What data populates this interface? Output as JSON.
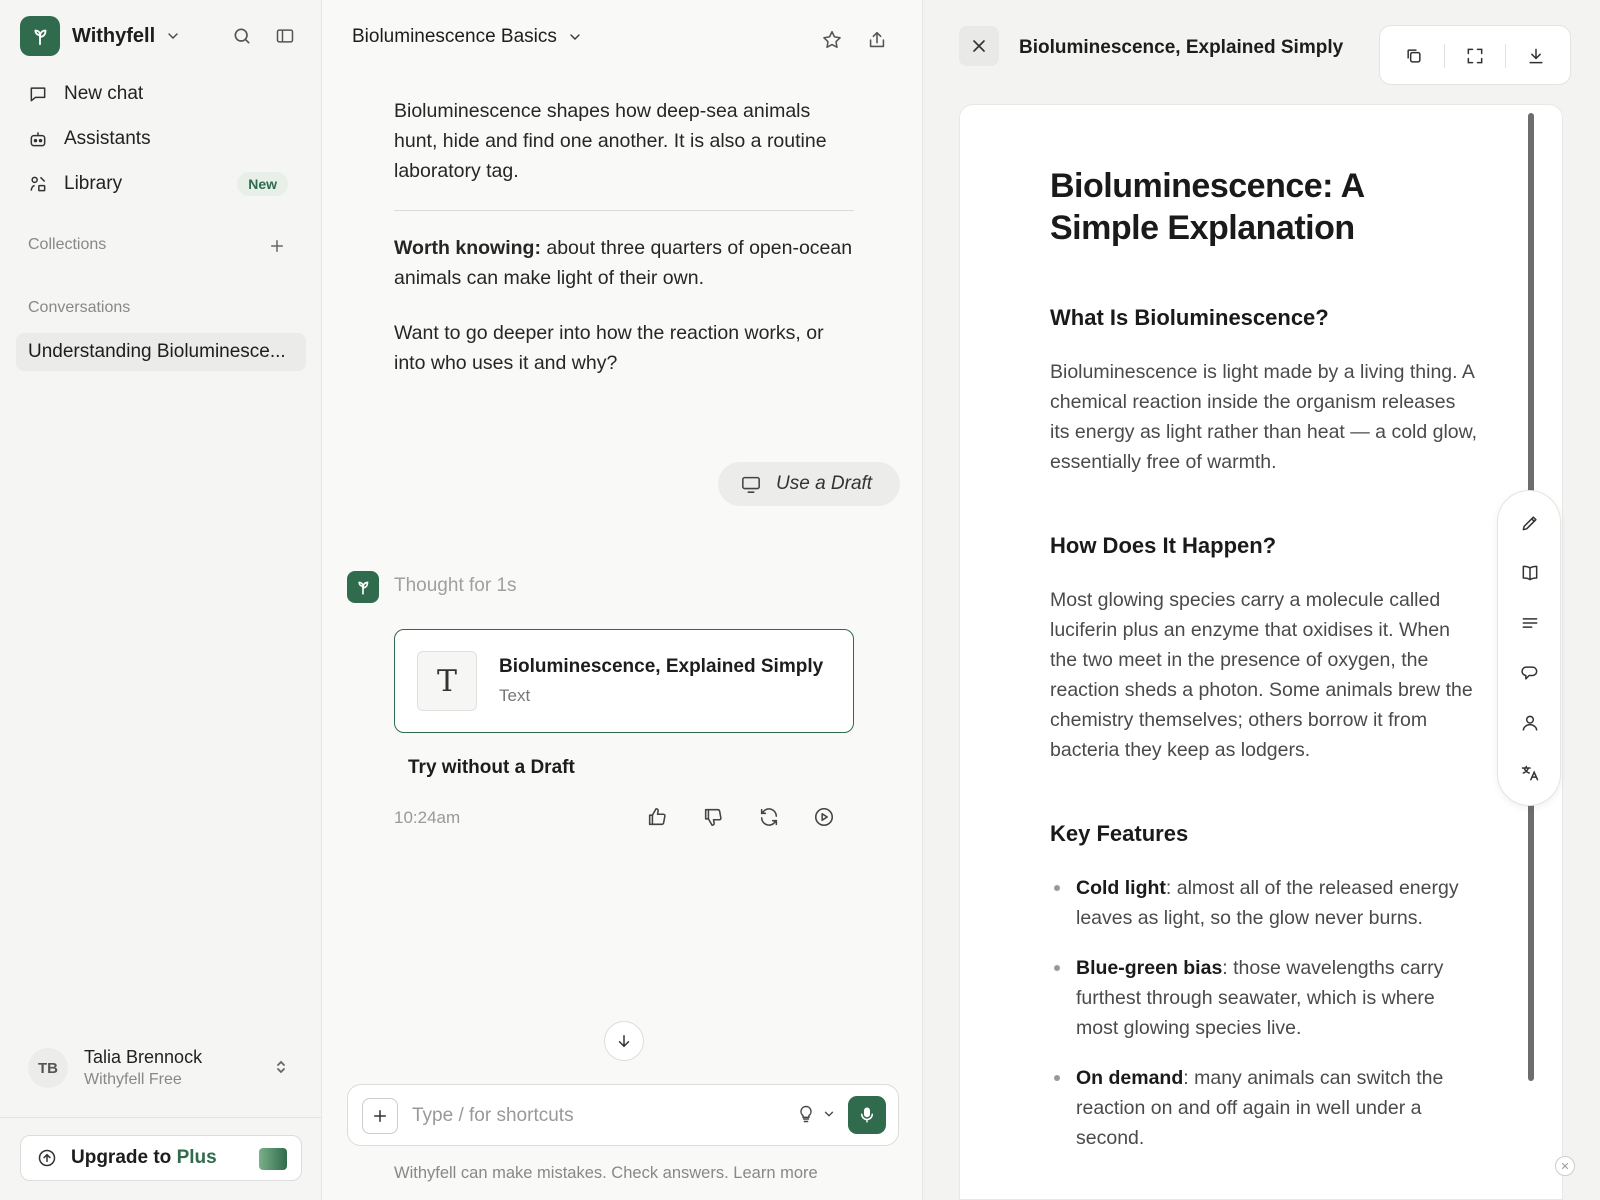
{
  "sidebar": {
    "brand": "Withyfell",
    "nav": [
      {
        "label": "New chat"
      },
      {
        "label": "Assistants"
      },
      {
        "label": "Library",
        "badge": "New"
      }
    ],
    "collections_title": "Collections",
    "conversations_title": "Conversations",
    "conversations": [
      "Understanding Bioluminesce..."
    ],
    "user": {
      "initials": "TB",
      "name": "Talia Brennock",
      "plan": "Withyfell Free"
    },
    "upgrade": {
      "prefix": "Upgrade to",
      "plan": "Plus"
    }
  },
  "chat": {
    "title": "Bioluminescence Basics",
    "messages": {
      "intro": "Bioluminescence shapes how deep-sea animals hunt, hide and find one another. It is also a routine laboratory tag.",
      "worth_label": "Worth knowing:",
      "worth_text": " about three quarters of open-ocean animals can make light of their own.",
      "question": "Want to go deeper into how the reaction works, or into who uses it and why?"
    },
    "draft_pill": "Use a Draft",
    "thought": "Thought for 1s",
    "artifact": {
      "icon_letter": "T",
      "title": "Bioluminescence, Explained Simply",
      "type": "Text"
    },
    "try_without": "Try without a Draft",
    "time": "10:24am",
    "composer": {
      "placeholder": "Type / for shortcuts"
    },
    "disclaimer": "Withyfell can make mistakes. Check answers.",
    "learn_more": "Learn more"
  },
  "panel": {
    "title": "Bioluminescence, Explained Simply",
    "doc": {
      "h1": "Bioluminescence: A Simple Explanation",
      "s1_title": "What Is Bioluminescence?",
      "s1_text": "Bioluminescence is light made by a living thing. A chemical reaction inside the organism releases its energy as light rather than heat — a cold glow, essentially free of warmth.",
      "s2_title": "How Does It Happen?",
      "s2_text": "Most glowing species carry a molecule called luciferin plus an enzyme that oxidises it. When the two meet in the presence of oxygen, the reaction sheds a photon. Some animals brew the chemistry themselves; others borrow it from bacteria they keep as lodgers.",
      "s3_title": "Key Features",
      "features": [
        {
          "term": "Cold light",
          "text": ": almost all of the released energy leaves as light, so the glow never burns."
        },
        {
          "term": "Blue-green bias",
          "text": ": those wavelengths carry furthest through seawater, which is where most glowing species live."
        },
        {
          "term": "On demand",
          "text": ": many animals can switch the reaction on and off again in well under a second."
        }
      ]
    }
  },
  "colors": {
    "accent": "#2f6b4c",
    "sidebar_bg": "#f5f5f4",
    "page_bg": "#f9f9f8"
  }
}
